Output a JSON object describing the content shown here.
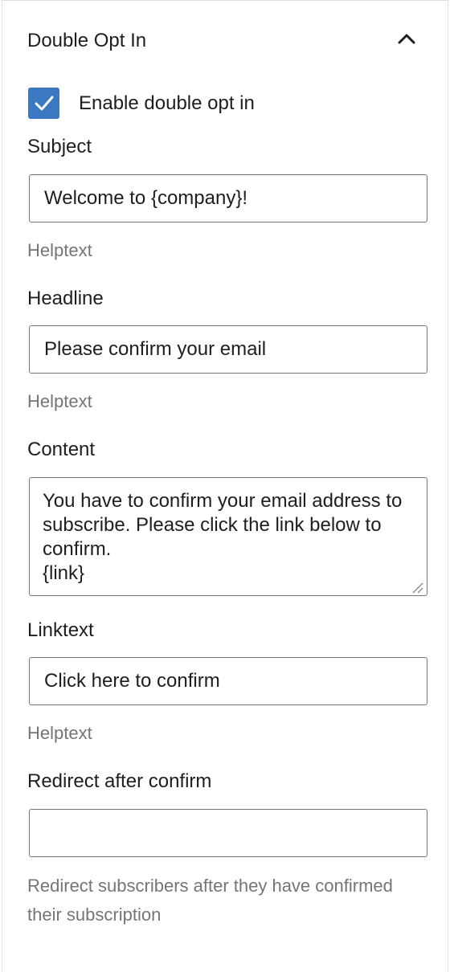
{
  "panel": {
    "title": "Double Opt In",
    "toggle_icon": "chevron-up-icon"
  },
  "enable": {
    "label": "Enable double opt in",
    "checked": true
  },
  "subject": {
    "label": "Subject",
    "value": "Welcome to {company}!",
    "help": "Helptext"
  },
  "headline": {
    "label": "Headline",
    "value": "Please confirm your email",
    "help": "Helptext"
  },
  "content": {
    "label": "Content",
    "value": "You have to confirm your email address to subscribe. Please click the link below to confirm.\n{link}"
  },
  "linktext": {
    "label": "Linktext",
    "value": "Click here to confirm",
    "help": "Helptext"
  },
  "redirect": {
    "label": "Redirect after confirm",
    "value": "",
    "help": "Redirect subscribers after they have confirmed their subscription"
  },
  "colors": {
    "accent": "#3b78c2",
    "help_text": "#757575",
    "border": "#757575"
  }
}
